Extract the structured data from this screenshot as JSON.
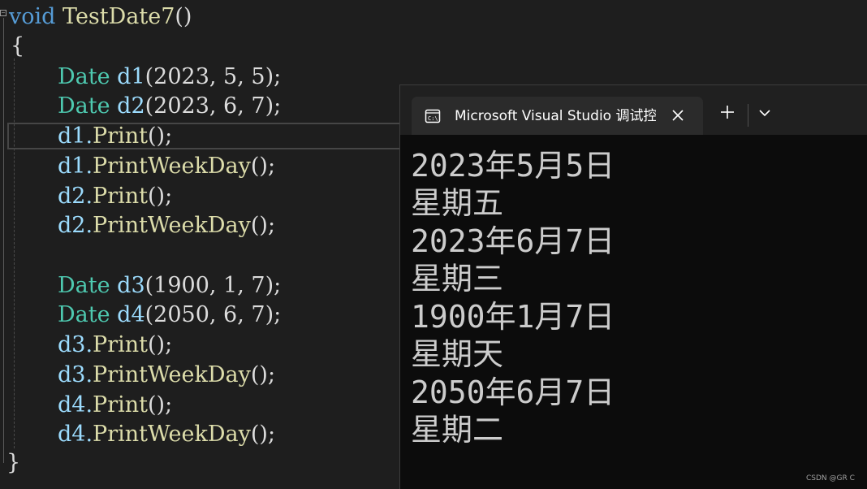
{
  "editor": {
    "func_keyword": "void",
    "func_name": "TestDate7",
    "func_parens": "()",
    "open_brace": "{",
    "close_brace": "}",
    "lines": [
      {
        "type": "Date",
        "var": "d1",
        "args": "(2023, 5, 5);"
      },
      {
        "type": "Date",
        "var": "d2",
        "args": "(2023, 6, 7);"
      },
      {
        "obj": "d1.",
        "method": "Print",
        "tail": "();"
      },
      {
        "obj": "d1.",
        "method": "PrintWeekDay",
        "tail": "();"
      },
      {
        "obj": "d2.",
        "method": "Print",
        "tail": "();"
      },
      {
        "obj": "d2.",
        "method": "PrintWeekDay",
        "tail": "();"
      },
      {
        "type": "Date",
        "var": "d3",
        "args": "(1900, 1, 7);"
      },
      {
        "type": "Date",
        "var": "d4",
        "args": "(2050, 6, 7);"
      },
      {
        "obj": "d3.",
        "method": "Print",
        "tail": "();"
      },
      {
        "obj": "d3.",
        "method": "PrintWeekDay",
        "tail": "();"
      },
      {
        "obj": "d4.",
        "method": "Print",
        "tail": "();"
      },
      {
        "obj": "d4.",
        "method": "PrintWeekDay",
        "tail": "();"
      }
    ]
  },
  "console": {
    "tab_title": "Microsoft Visual Studio 调试控制台",
    "tab_icon": "console-window-icon",
    "close_icon": "close-icon",
    "new_tab_icon": "plus-icon",
    "dropdown_icon": "chevron-down-icon",
    "output": [
      "2023年5月5日",
      "星期五",
      "2023年6月7日",
      "星期三",
      "1900年1月7日",
      "星期天",
      "2050年6月7日",
      "星期二"
    ]
  },
  "watermark": "CSDN @GR C",
  "colors": {
    "keyword": "#569cd6",
    "type": "#4ec9b0",
    "variable": "#9cdcfe",
    "function": "#dcdcaa",
    "number": "#b5cea8",
    "editor_bg": "#1e1e1e",
    "console_bg": "#0c0c0c"
  }
}
